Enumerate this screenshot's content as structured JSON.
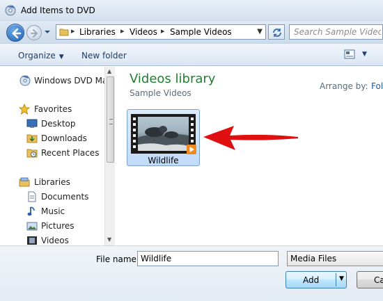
{
  "window": {
    "title": "Add Items to DVD"
  },
  "address": {
    "crumbs": [
      "Libraries",
      "Videos",
      "Sample Videos"
    ],
    "search_placeholder": "Search Sample Videos"
  },
  "toolbar": {
    "organize": "Organize",
    "new_folder": "New folder"
  },
  "nav": {
    "top_item": "Windows DVD Mak",
    "favorites": "Favorites",
    "favorites_items": [
      "Desktop",
      "Downloads",
      "Recent Places"
    ],
    "libraries": "Libraries",
    "libraries_items": [
      "Documents",
      "Music",
      "Pictures",
      "Videos"
    ]
  },
  "content": {
    "library_title": "Videos library",
    "library_subtitle": "Sample Videos",
    "arrange_label": "Arrange by:",
    "arrange_value": "Fol",
    "files": [
      {
        "name": "Wildlife",
        "type": "video"
      }
    ]
  },
  "footer": {
    "file_name_label": "File name:",
    "file_name_value": "Wildlife",
    "filter_value": "Media Files",
    "add_label": "Add",
    "cancel_label": "Ca"
  },
  "colors": {
    "accent_title": "#1e7f2e",
    "selection": "#c1dbfa",
    "arrow": "#e01010"
  }
}
